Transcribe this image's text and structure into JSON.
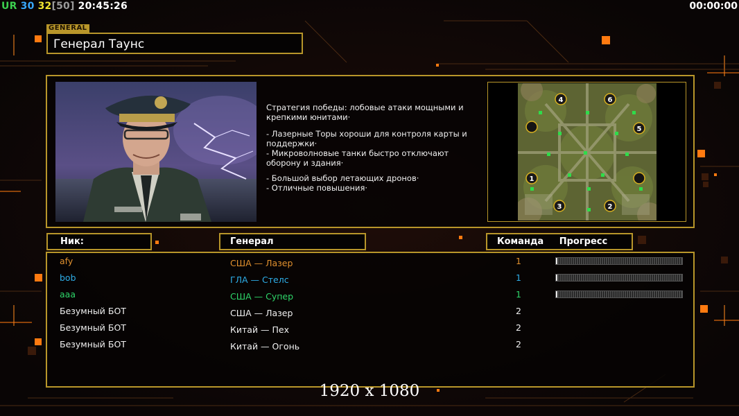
{
  "hud": {
    "ur_label": "UR",
    "fps": "30",
    "target_fps": "32",
    "bracket_value": "[50]",
    "clock": "20:45:26",
    "game_timer": "00:00:00"
  },
  "general": {
    "tag": "GENERAL",
    "name": "Генерал Таунс"
  },
  "strategy": {
    "intro": "Стратегия победы: лобовые атаки мощными и крепкими юнитами·",
    "bullets": [
      "- Лазерные Торы хороши для контроля карты и поддержки·",
      "- Микроволновые танки быстро отключают оборону и здания·"
    ],
    "bullets2": [
      "- Большой выбор летающих дронов·",
      "- Отличные повышения·"
    ]
  },
  "map": {
    "slots": [
      "1",
      "2",
      "3",
      "4",
      "5",
      "6"
    ]
  },
  "columns": {
    "nick": "Ник:",
    "general": "Генерал",
    "team": "Команда",
    "progress": "Прогресс"
  },
  "players": [
    {
      "nick": "afy",
      "general": "США — Лазер",
      "team": "1",
      "color": "#e0902e",
      "progress": 0.01
    },
    {
      "nick": "bob",
      "general": "ГЛА — Стелс",
      "team": "1",
      "color": "#2eaee8",
      "progress": 0.01
    },
    {
      "nick": "aaa",
      "general": "США — Супер",
      "team": "1",
      "color": "#2ed66a",
      "progress": 0.0
    },
    {
      "nick": "Безумный БОТ",
      "general": "США — Лазер",
      "team": "2",
      "color": "#f0f0f0"
    },
    {
      "nick": "Безумный БОТ",
      "general": "Китай — Пех",
      "team": "2",
      "color": "#f0f0f0"
    },
    {
      "nick": "Безумный БОТ",
      "general": "Китай — Огонь",
      "team": "2",
      "color": "#f0f0f0"
    }
  ],
  "resolution_label": "1920 x 1080",
  "colors": {
    "frame_gold": "#b8962a",
    "accent_orange": "#ff7a10",
    "hud_ur": "#3ccf4e",
    "hud_fps": "#38a8ff",
    "hud_target": "#f2e630",
    "hud_bracket": "#9a9a9a"
  }
}
